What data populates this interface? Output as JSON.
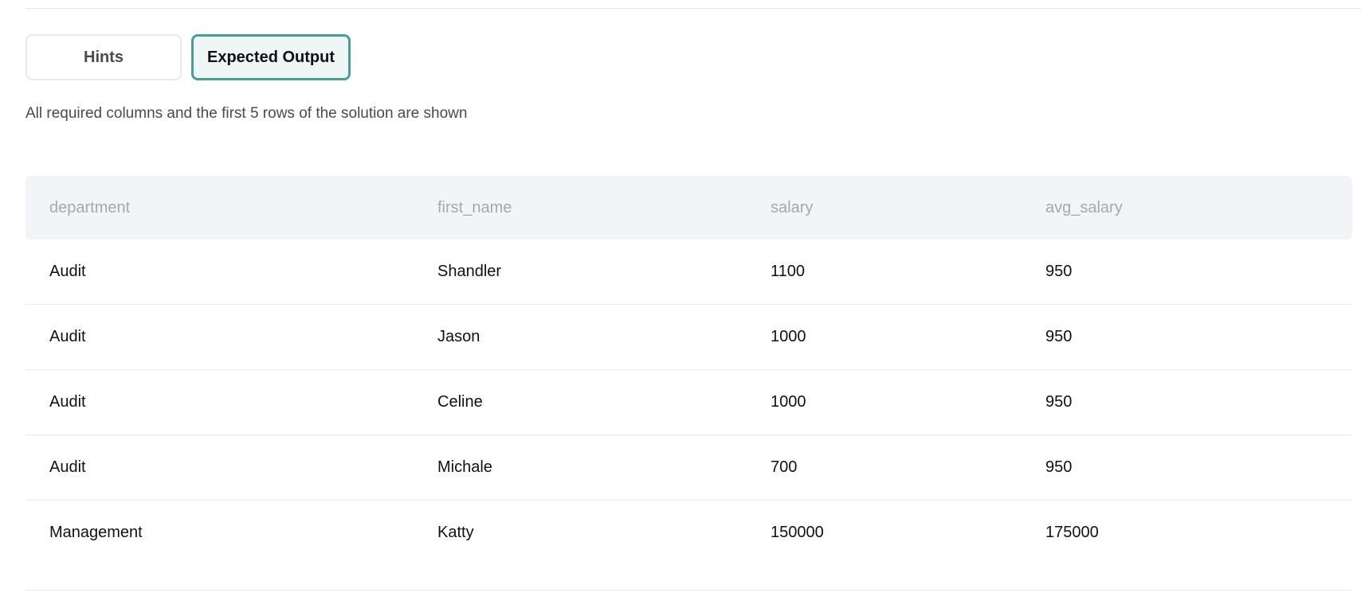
{
  "tabs": {
    "hints_label": "Hints",
    "expected_label": "Expected Output"
  },
  "note": "All required columns and the first 5 rows of the solution are shown",
  "table": {
    "columns": [
      "department",
      "first_name",
      "salary",
      "avg_salary"
    ],
    "rows": [
      [
        "Audit",
        "Shandler",
        "1100",
        "950"
      ],
      [
        "Audit",
        "Jason",
        "1000",
        "950"
      ],
      [
        "Audit",
        "Celine",
        "1000",
        "950"
      ],
      [
        "Audit",
        "Michale",
        "700",
        "950"
      ],
      [
        "Management",
        "Katty",
        "150000",
        "175000"
      ]
    ]
  },
  "colors": {
    "accent": "#4a9d99",
    "accent_bg": "#eef7f6",
    "header_bg": "#f3f4f7",
    "header_text": "#a3a8b3"
  }
}
